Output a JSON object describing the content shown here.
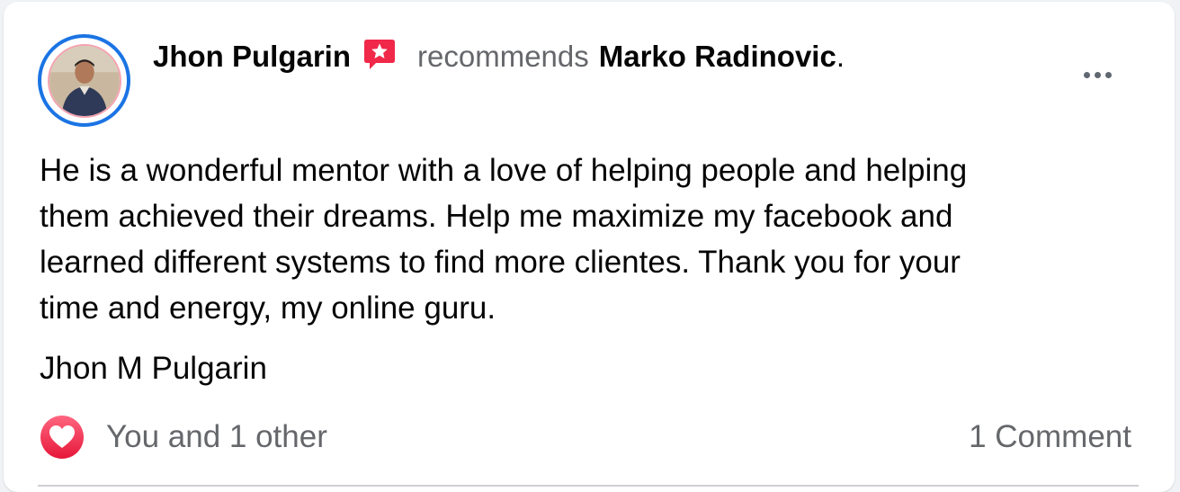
{
  "post": {
    "author": "Jhon Pulgarin",
    "action": "recommends",
    "recipient": "Marko Radinovic",
    "period": ".",
    "body_lines": [
      "He is a wonderful mentor with a love of helping people and helping",
      "them achieved their dreams. Help me maximize my facebook and",
      "learned different systems to find more clientes. Thank you for your",
      "time and energy, my online guru."
    ],
    "signature": "Jhon M Pulgarin"
  },
  "footer": {
    "reactions_text": "You and 1 other",
    "comments_text": "1 Comment"
  },
  "icons": {
    "recommendation": "recommendation-star-icon",
    "more": "more-options-icon",
    "reaction": "love-reaction-icon"
  },
  "colors": {
    "avatar_ring": "#1b74e4",
    "recommend_badge": "#f02849",
    "love_reaction": "#f33e58",
    "secondary_text": "#65676b",
    "primary_text": "#050505"
  }
}
